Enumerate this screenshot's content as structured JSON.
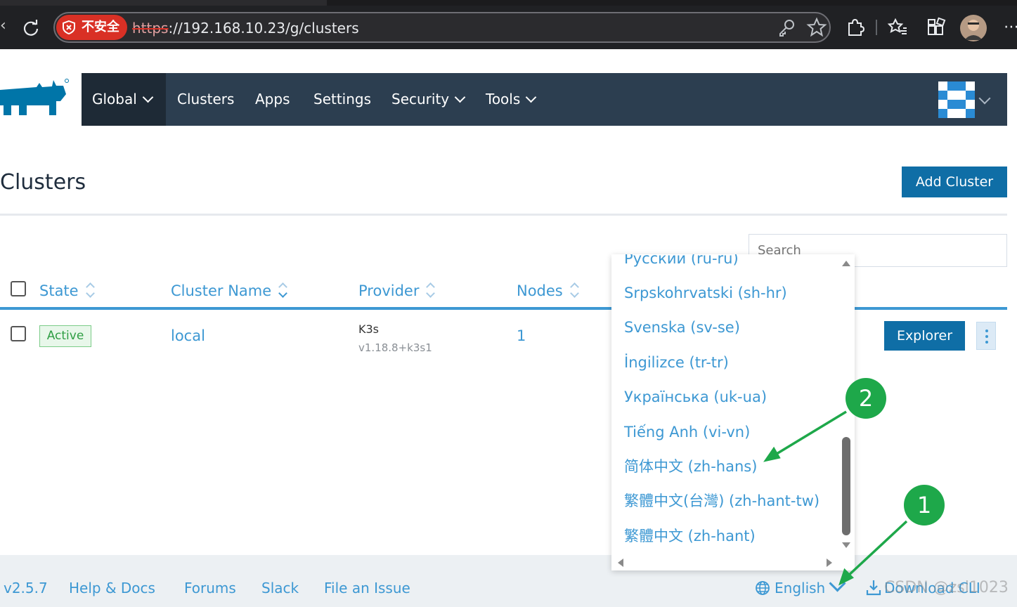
{
  "browser": {
    "security_label": "不安全",
    "url_scheme": "https",
    "url_rest": "://192.168.10.23/g/clusters",
    "icons": [
      "back-icon",
      "reload-icon",
      "shield-warning-icon",
      "key-icon",
      "star-icon",
      "extensions-icon",
      "favorites-icon",
      "collections-icon",
      "profile-avatar",
      "more-icon"
    ],
    "colors": {
      "insecure": "#d93025",
      "chrome": "#202124"
    }
  },
  "nav": {
    "items": [
      {
        "label": "Global",
        "dropdown": true
      },
      {
        "label": "Clusters",
        "dropdown": false
      },
      {
        "label": "Apps",
        "dropdown": false
      },
      {
        "label": "Settings",
        "dropdown": false
      },
      {
        "label": "Security",
        "dropdown": true
      },
      {
        "label": "Tools",
        "dropdown": true
      }
    ],
    "colors": {
      "bar": "#2c3e50",
      "active": "#1e2a36"
    }
  },
  "page": {
    "title": "Clusters",
    "add_button": "Add Cluster",
    "search_placeholder": "Search"
  },
  "table": {
    "columns": [
      "State",
      "Cluster Name",
      "Provider",
      "Nodes"
    ],
    "rows": [
      {
        "state": "Active",
        "name": "local",
        "provider": "K3s",
        "provider_version": "v1.18.8+k3s1",
        "nodes": "1",
        "action": "Explorer"
      }
    ],
    "colors": {
      "link": "#3d98d3",
      "active_badge": "#2f9e44",
      "primary_button": "#0f6ea6"
    }
  },
  "language_menu": {
    "items": [
      "Русский (ru-ru)",
      "Srpskohrvatski (sh-hr)",
      "Svenska (sv-se)",
      "İngilizce (tr-tr)",
      "Українська (uk-ua)",
      "Tiếng Anh (vi-vn)",
      "简体中文 (zh-hans)",
      "繁體中文(台灣) (zh-hant-tw)",
      "繁體中文 (zh-hant)"
    ]
  },
  "footer": {
    "version": "v2.5.7",
    "links": [
      "Help & Docs",
      "Forums",
      "Slack",
      "File an Issue"
    ],
    "language": "English",
    "download_cli": "Download CLI",
    "watermark": "CSDN @zsl1023"
  },
  "annotations": [
    {
      "label": "1",
      "color": "#1ea84a"
    },
    {
      "label": "2",
      "color": "#1ea84a"
    }
  ]
}
